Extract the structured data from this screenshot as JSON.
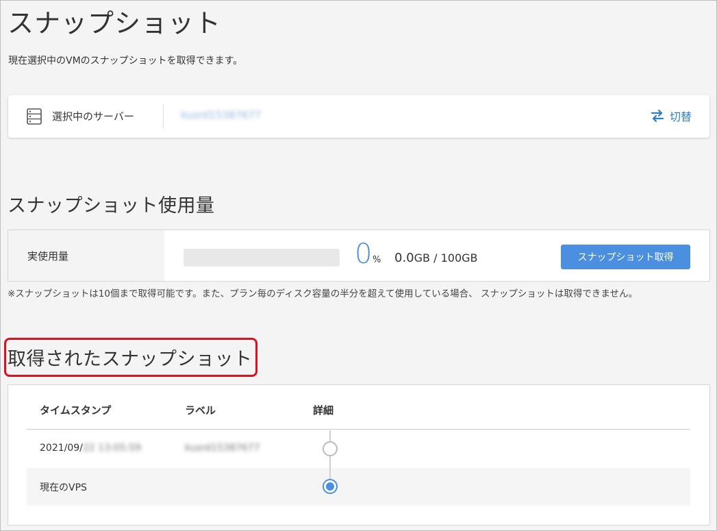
{
  "page": {
    "title": "スナップショット",
    "description": "現在選択中のVMのスナップショットを取得できます。"
  },
  "server": {
    "label": "選択中のサーバー",
    "name": "kusrd15387677",
    "switch_label": "切替"
  },
  "usage": {
    "section_title": "スナップショット使用量",
    "label": "実使用量",
    "percent": "0",
    "percent_sign": "%",
    "used": "0.0",
    "unit_used": "GB",
    "separator": " / ",
    "total": "100GB",
    "button_label": "スナップショット取得",
    "progress_fraction": 0,
    "note": "※スナップショットは10個まで取得可能です。また、プラン毎のディスク容量の半分を超えて使用している場合、 スナップショットは取得できません。"
  },
  "snapshots": {
    "section_title": "取得されたスナップショット",
    "columns": [
      "タイムスタンプ",
      "ラベル",
      "詳細"
    ],
    "rows": [
      {
        "timestamp_visible": "2021/09/",
        "timestamp_blurred": "22 13:05:59",
        "label": "kusrd15387677",
        "selected": false
      },
      {
        "timestamp_visible": "現在のVPS",
        "timestamp_blurred": "",
        "label": "",
        "selected": true
      }
    ]
  },
  "colors": {
    "accent": "#4a8fe0",
    "link": "#2f7cc2",
    "highlight": "#d9121e"
  }
}
